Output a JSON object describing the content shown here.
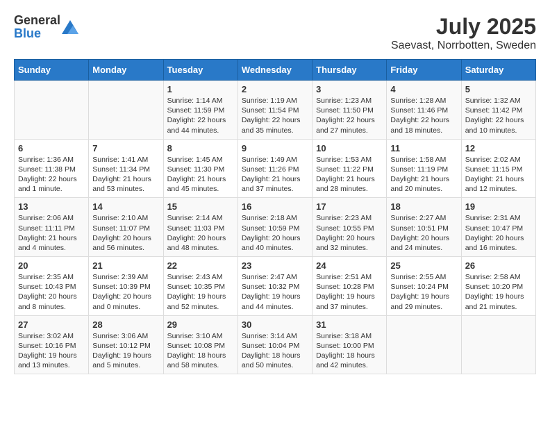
{
  "header": {
    "logo_general": "General",
    "logo_blue": "Blue",
    "month": "July 2025",
    "location": "Saevast, Norrbotten, Sweden"
  },
  "weekdays": [
    "Sunday",
    "Monday",
    "Tuesday",
    "Wednesday",
    "Thursday",
    "Friday",
    "Saturday"
  ],
  "weeks": [
    [
      {
        "day": "",
        "info": ""
      },
      {
        "day": "",
        "info": ""
      },
      {
        "day": "1",
        "info": "Sunrise: 1:14 AM\nSunset: 11:59 PM\nDaylight: 22 hours and 44 minutes."
      },
      {
        "day": "2",
        "info": "Sunrise: 1:19 AM\nSunset: 11:54 PM\nDaylight: 22 hours and 35 minutes."
      },
      {
        "day": "3",
        "info": "Sunrise: 1:23 AM\nSunset: 11:50 PM\nDaylight: 22 hours and 27 minutes."
      },
      {
        "day": "4",
        "info": "Sunrise: 1:28 AM\nSunset: 11:46 PM\nDaylight: 22 hours and 18 minutes."
      },
      {
        "day": "5",
        "info": "Sunrise: 1:32 AM\nSunset: 11:42 PM\nDaylight: 22 hours and 10 minutes."
      }
    ],
    [
      {
        "day": "6",
        "info": "Sunrise: 1:36 AM\nSunset: 11:38 PM\nDaylight: 22 hours and 1 minute."
      },
      {
        "day": "7",
        "info": "Sunrise: 1:41 AM\nSunset: 11:34 PM\nDaylight: 21 hours and 53 minutes."
      },
      {
        "day": "8",
        "info": "Sunrise: 1:45 AM\nSunset: 11:30 PM\nDaylight: 21 hours and 45 minutes."
      },
      {
        "day": "9",
        "info": "Sunrise: 1:49 AM\nSunset: 11:26 PM\nDaylight: 21 hours and 37 minutes."
      },
      {
        "day": "10",
        "info": "Sunrise: 1:53 AM\nSunset: 11:22 PM\nDaylight: 21 hours and 28 minutes."
      },
      {
        "day": "11",
        "info": "Sunrise: 1:58 AM\nSunset: 11:19 PM\nDaylight: 21 hours and 20 minutes."
      },
      {
        "day": "12",
        "info": "Sunrise: 2:02 AM\nSunset: 11:15 PM\nDaylight: 21 hours and 12 minutes."
      }
    ],
    [
      {
        "day": "13",
        "info": "Sunrise: 2:06 AM\nSunset: 11:11 PM\nDaylight: 21 hours and 4 minutes."
      },
      {
        "day": "14",
        "info": "Sunrise: 2:10 AM\nSunset: 11:07 PM\nDaylight: 20 hours and 56 minutes."
      },
      {
        "day": "15",
        "info": "Sunrise: 2:14 AM\nSunset: 11:03 PM\nDaylight: 20 hours and 48 minutes."
      },
      {
        "day": "16",
        "info": "Sunrise: 2:18 AM\nSunset: 10:59 PM\nDaylight: 20 hours and 40 minutes."
      },
      {
        "day": "17",
        "info": "Sunrise: 2:23 AM\nSunset: 10:55 PM\nDaylight: 20 hours and 32 minutes."
      },
      {
        "day": "18",
        "info": "Sunrise: 2:27 AM\nSunset: 10:51 PM\nDaylight: 20 hours and 24 minutes."
      },
      {
        "day": "19",
        "info": "Sunrise: 2:31 AM\nSunset: 10:47 PM\nDaylight: 20 hours and 16 minutes."
      }
    ],
    [
      {
        "day": "20",
        "info": "Sunrise: 2:35 AM\nSunset: 10:43 PM\nDaylight: 20 hours and 8 minutes."
      },
      {
        "day": "21",
        "info": "Sunrise: 2:39 AM\nSunset: 10:39 PM\nDaylight: 20 hours and 0 minutes."
      },
      {
        "day": "22",
        "info": "Sunrise: 2:43 AM\nSunset: 10:35 PM\nDaylight: 19 hours and 52 minutes."
      },
      {
        "day": "23",
        "info": "Sunrise: 2:47 AM\nSunset: 10:32 PM\nDaylight: 19 hours and 44 minutes."
      },
      {
        "day": "24",
        "info": "Sunrise: 2:51 AM\nSunset: 10:28 PM\nDaylight: 19 hours and 37 minutes."
      },
      {
        "day": "25",
        "info": "Sunrise: 2:55 AM\nSunset: 10:24 PM\nDaylight: 19 hours and 29 minutes."
      },
      {
        "day": "26",
        "info": "Sunrise: 2:58 AM\nSunset: 10:20 PM\nDaylight: 19 hours and 21 minutes."
      }
    ],
    [
      {
        "day": "27",
        "info": "Sunrise: 3:02 AM\nSunset: 10:16 PM\nDaylight: 19 hours and 13 minutes."
      },
      {
        "day": "28",
        "info": "Sunrise: 3:06 AM\nSunset: 10:12 PM\nDaylight: 19 hours and 5 minutes."
      },
      {
        "day": "29",
        "info": "Sunrise: 3:10 AM\nSunset: 10:08 PM\nDaylight: 18 hours and 58 minutes."
      },
      {
        "day": "30",
        "info": "Sunrise: 3:14 AM\nSunset: 10:04 PM\nDaylight: 18 hours and 50 minutes."
      },
      {
        "day": "31",
        "info": "Sunrise: 3:18 AM\nSunset: 10:00 PM\nDaylight: 18 hours and 42 minutes."
      },
      {
        "day": "",
        "info": ""
      },
      {
        "day": "",
        "info": ""
      }
    ]
  ]
}
